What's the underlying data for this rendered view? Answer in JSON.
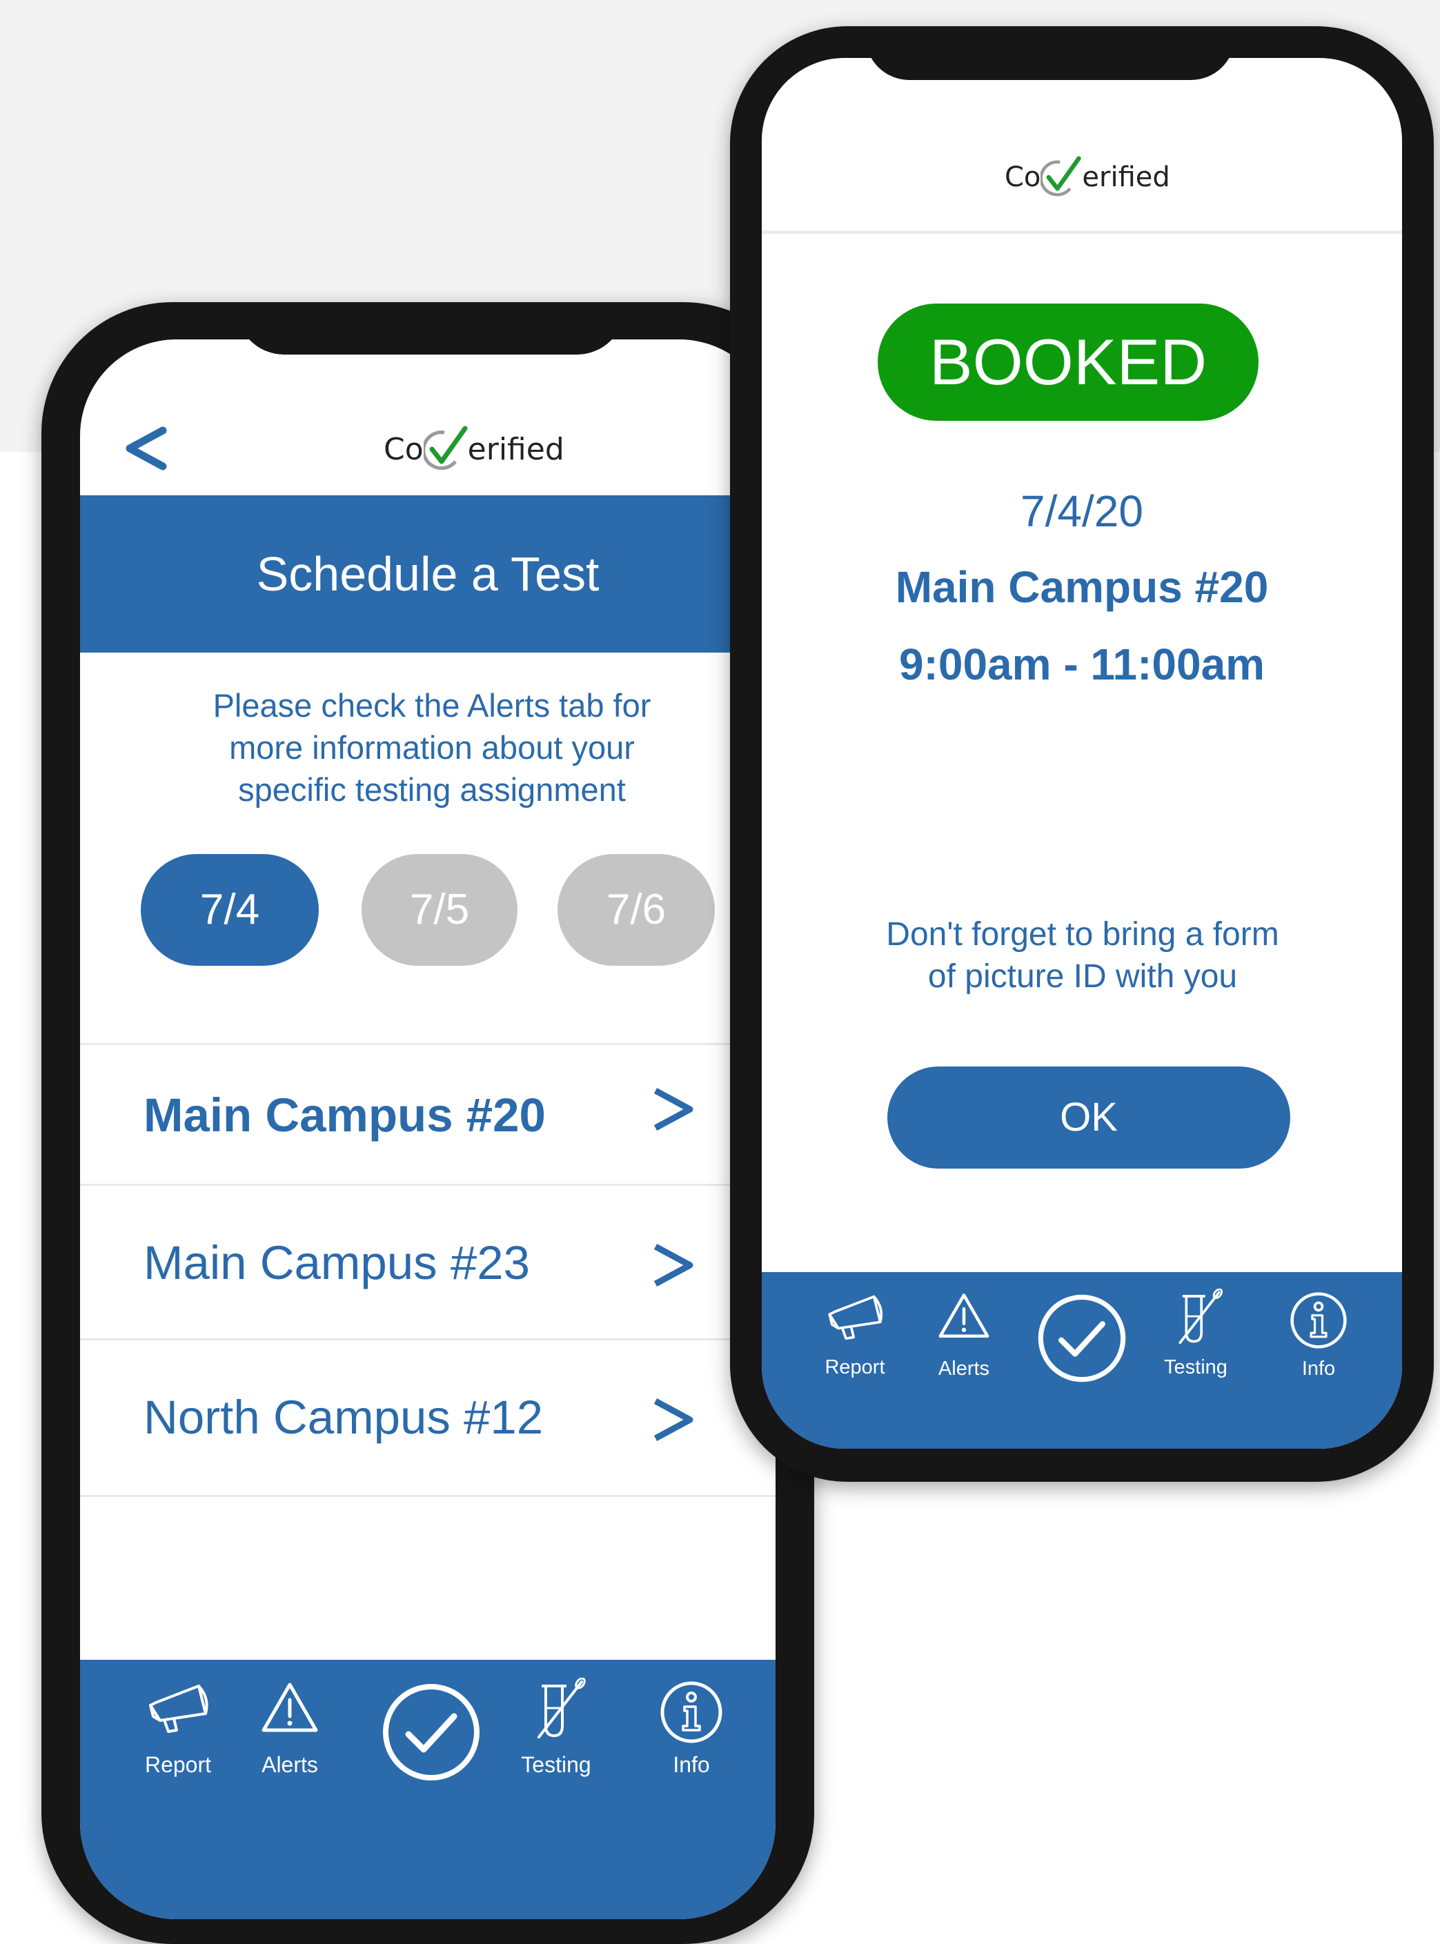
{
  "brand": {
    "logo_prefix": "Co",
    "logo_suffix": "erified"
  },
  "schedule_screen": {
    "title": "Schedule a Test",
    "info_lines": [
      "Please check the Alerts tab for",
      "more information about your",
      "specific testing assignment"
    ],
    "dates": [
      {
        "label": "7/4",
        "selected": true
      },
      {
        "label": "7/5",
        "selected": false
      },
      {
        "label": "7/6",
        "selected": false
      }
    ],
    "locations": [
      {
        "label": "Main Campus #20",
        "bold": true
      },
      {
        "label": "Main Campus #23",
        "bold": false
      },
      {
        "label": "North Campus #12",
        "bold": false
      }
    ]
  },
  "booked_screen": {
    "status": "BOOKED",
    "date": "7/4/20",
    "location": "Main Campus #20",
    "time": "9:00am - 11:00am",
    "reminder_lines": [
      "Don't forget to bring a form",
      "of picture ID with you"
    ],
    "ok_label": "OK"
  },
  "tabbar": {
    "items": [
      {
        "label": "Report",
        "icon": "megaphone-icon"
      },
      {
        "label": "Alerts",
        "icon": "warning-icon"
      },
      {
        "label": "",
        "icon": "check-circle-icon"
      },
      {
        "label": "Testing",
        "icon": "test-tube-icon"
      },
      {
        "label": "Info",
        "icon": "info-icon"
      }
    ]
  },
  "colors": {
    "primary": "#2b6aab",
    "booked_green": "#0d9b0d",
    "inactive_pill": "#c4c4c4",
    "check_green": "#1f9a2e"
  }
}
